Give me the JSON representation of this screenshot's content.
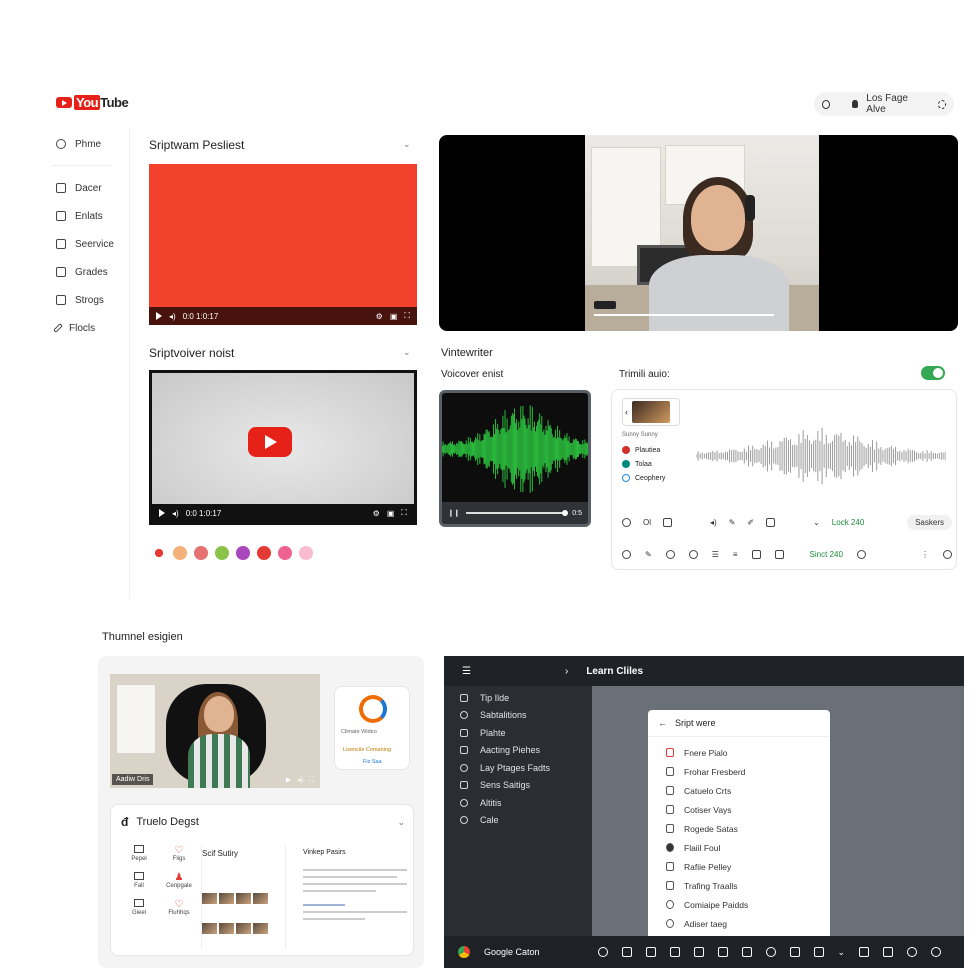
{
  "header": {
    "logo_text": "Tube",
    "logo_prefix": "You",
    "account_label": "Los Fage Alve"
  },
  "sidebar": {
    "items": [
      {
        "label": "Phme",
        "icon": "home-icon"
      },
      {
        "label": "Dacer",
        "icon": "folder-icon"
      },
      {
        "label": "Enlats",
        "icon": "link-icon"
      },
      {
        "label": "Seervice",
        "icon": "service-icon"
      },
      {
        "label": "Grades",
        "icon": "grade-icon"
      },
      {
        "label": "Strogs",
        "icon": "storage-icon"
      },
      {
        "label": "Flocls",
        "icon": "pen-icon"
      }
    ]
  },
  "playlists": {
    "first_title": "Sriptwam Pesliest",
    "second_title": "Sriptvoiver noist",
    "player1_time": "0:0 1:0:17",
    "player2_time": "0:0 1:0:17"
  },
  "voice": {
    "section_title": "Vintewriter",
    "voiceover_label": "Voicover enist",
    "trim_label": "Trimili auio:",
    "waveform_controls": "0:5"
  },
  "trim_panel": {
    "track_caption": "Sunny Sunny",
    "sub_items": [
      "Plautiea",
      "Tolaa",
      "Ceophery"
    ],
    "toolbar_left": "Ol",
    "toolbar_count_a": "Lock 240",
    "toolbar_count_b": "Sinct 240",
    "save_label": "Saskers",
    "bottom_label": "Lock"
  },
  "thumbnail": {
    "section_title": "Thumnel esigien",
    "caption_button": "Aadiw Dris",
    "card_title_small": "Climate Wideo",
    "card_sub": "Lisencile Comaning",
    "card_link": "Fiz Saa"
  },
  "trudo": {
    "title": "Truelo Degst",
    "grid_labels": [
      "Pepel",
      "Fligs",
      "Fall",
      "Cenpgale",
      "Gieel",
      "Fluhhqs"
    ],
    "middle_title": "Scif Sutiry",
    "right_title": "Vinkep Pasirs"
  },
  "learn": {
    "title": "Learn Cliles",
    "menu": [
      "Tip Ilde",
      "Sabtalitions",
      "Plahte",
      "Aacting Piehes",
      "Lay Ptages Fadts",
      "Sens Saitigs",
      "Altitis",
      "Cale"
    ],
    "dialog_title": "Sript were",
    "dialog_items": [
      "Fnere Pialo",
      "Frohar Fresberd",
      "Catuelo Crts",
      "Cotiser Vays",
      "Rogede Satas",
      "Flaiil Foul",
      "Rafiie Pelley",
      "Trafing Traalls",
      "Comiaipe Paidds",
      "Adiser taeg"
    ],
    "taskbar_label": "Google Caton"
  },
  "colors": {
    "brand_red": "#e62117",
    "toggle_green": "#34a853",
    "wave_green": "#2bbd3d",
    "dark_panel": "#2a2e33"
  }
}
